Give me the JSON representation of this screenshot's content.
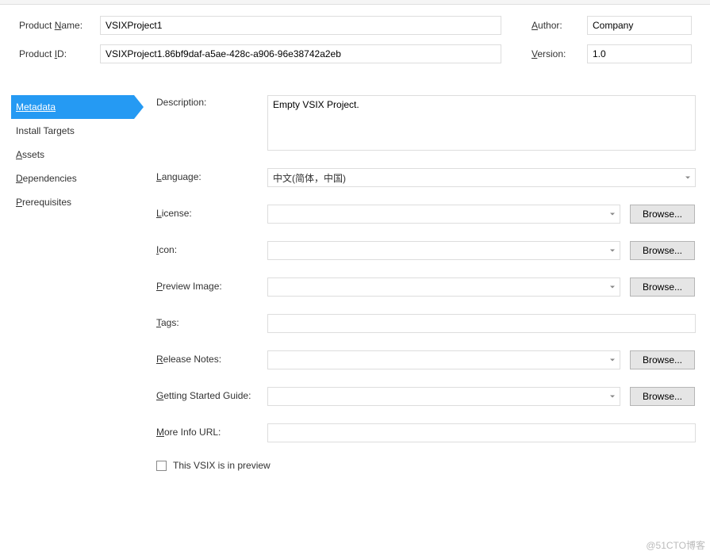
{
  "header": {
    "product_name_label_pre": "Product ",
    "product_name_mnemonic": "N",
    "product_name_label_post": "ame:",
    "product_name_value": "VSIXProject1",
    "product_id_label_pre": "Product ",
    "product_id_mnemonic": "I",
    "product_id_label_post": "D:",
    "product_id_value": "VSIXProject1.86bf9daf-a5ae-428c-a906-96e38742a2eb",
    "author_mnemonic": "A",
    "author_label_post": "uthor:",
    "author_value": "Company",
    "version_mnemonic": "V",
    "version_label_post": "ersion:",
    "version_value": "1.0"
  },
  "sidebar": {
    "items": [
      {
        "mnemonic": "M",
        "rest": "etadata",
        "active": true
      },
      {
        "mnemonic": "",
        "rest": "Install Targets",
        "active": false
      },
      {
        "mnemonic": "A",
        "rest": "ssets",
        "active": false
      },
      {
        "mnemonic": "D",
        "rest": "ependencies",
        "active": false
      },
      {
        "mnemonic": "P",
        "rest": "rerequisites",
        "active": false
      }
    ]
  },
  "form": {
    "description_label": "Description:",
    "description_value": "Empty VSIX Project.",
    "language_mnemonic": "L",
    "language_rest": "anguage:",
    "language_value": "中文(简体，中国)",
    "license_mnemonic": "L",
    "license_rest": "icense:",
    "license_value": "",
    "icon_mnemonic": "I",
    "icon_rest": "con:",
    "icon_value": "",
    "preview_mnemonic": "P",
    "preview_rest": "review Image:",
    "preview_value": "",
    "tags_mnemonic": "T",
    "tags_rest": "ags:",
    "tags_value": "",
    "release_mnemonic": "R",
    "release_rest": "elease Notes:",
    "release_value": "",
    "getting_mnemonic": "G",
    "getting_rest": "etting Started Guide:",
    "getting_value": "",
    "more_mnemonic": "M",
    "more_rest": "ore Info URL:",
    "more_value": "",
    "preview_checkbox_label": "This VSIX is in preview",
    "browse_label": "Browse..."
  },
  "watermark": "@51CTO博客"
}
